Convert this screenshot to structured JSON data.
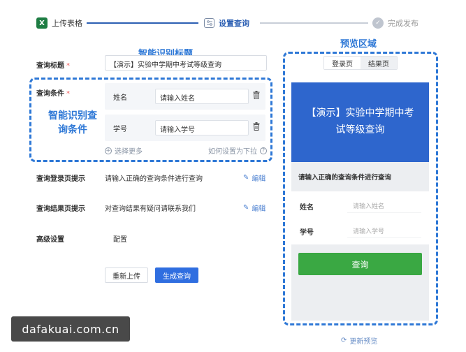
{
  "stepper": {
    "steps": [
      {
        "label": "上传表格",
        "icon": "excel-icon"
      },
      {
        "label": "设置查询",
        "icon": "settings-panel-icon"
      },
      {
        "label": "完成发布",
        "icon": "check-circle-icon"
      }
    ]
  },
  "annotations": {
    "title": "智能识别标题",
    "conditions": "智能识别查询条件",
    "preview": "预览区域"
  },
  "form": {
    "title_label": "查询标题",
    "title_value": "【演示】实验中学期中考试等级查询",
    "conditions_label": "查询条件",
    "conditions": [
      {
        "name": "姓名",
        "placeholder": "请输入姓名"
      },
      {
        "name": "学号",
        "placeholder": "请输入学号"
      }
    ],
    "more_label": "选择更多",
    "howto_label": "如何设置为下拉",
    "login_tip_label": "查询登录页提示",
    "login_tip_value": "请输入正确的查询条件进行查询",
    "result_tip_label": "查询结果页提示",
    "result_tip_value": "对查询结果有疑问请联系我们",
    "edit_label": "编辑",
    "advanced_label": "高级设置",
    "advanced_value": "配置",
    "reupload_label": "重新上传",
    "generate_label": "生成查询"
  },
  "preview": {
    "tabs": [
      "登录页",
      "结果页"
    ],
    "active_tab": 0,
    "banner_line1": "【演示】实验中学期中考",
    "banner_line2": "试等级查询",
    "prompt": "请输入正确的查询条件进行查询",
    "fields": [
      {
        "label": "姓名",
        "placeholder": "请输入姓名"
      },
      {
        "label": "学号",
        "placeholder": "请输入学号"
      }
    ],
    "query_button": "查询",
    "refresh_label": "更新预览"
  },
  "watermark": "dafakuai.com.cn",
  "colors": {
    "accent": "#2e78d6",
    "primary_button": "#2f6ee0",
    "banner": "#2e66cd",
    "query_button": "#3aa843",
    "excel": "#1e7d43"
  }
}
